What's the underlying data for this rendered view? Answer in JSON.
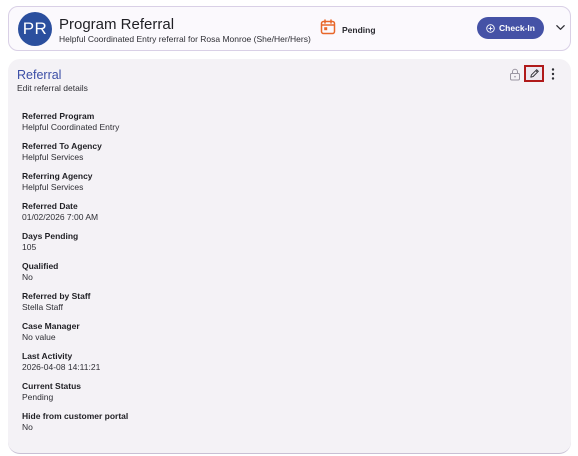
{
  "header": {
    "avatar_initials": "PR",
    "title": "Program Referral",
    "subtitle": "Helpful Coordinated Entry referral for Rosa Monroe (She/Her/Hers)",
    "status": "Pending",
    "checkin_label": "Check-In",
    "status_icon": "calendar-icon",
    "colors": {
      "avatar": "#2b4f9e",
      "checkin": "#4552a6",
      "status_icon": "#e8672a"
    }
  },
  "card": {
    "title": "Referral",
    "subtitle": "Edit referral details",
    "icons": [
      "lock-icon",
      "edit-icon",
      "more-vertical-icon"
    ],
    "fields": [
      {
        "label": "Referred Program",
        "value": "Helpful Coordinated Entry"
      },
      {
        "label": "Referred To Agency",
        "value": "Helpful Services"
      },
      {
        "label": "Referring Agency",
        "value": "Helpful Services"
      },
      {
        "label": "Referred Date",
        "value": "01/02/2026 7:00 AM"
      },
      {
        "label": "Days Pending",
        "value": "105"
      },
      {
        "label": "Qualified",
        "value": "No"
      },
      {
        "label": "Referred by Staff",
        "value": "Stella Staff"
      },
      {
        "label": "Case Manager",
        "value": "No value"
      },
      {
        "label": "Last Activity",
        "value": "2026-04-08 14:11:21"
      },
      {
        "label": "Current Status",
        "value": "Pending"
      },
      {
        "label": "Hide from customer portal",
        "value": "No"
      }
    ]
  }
}
